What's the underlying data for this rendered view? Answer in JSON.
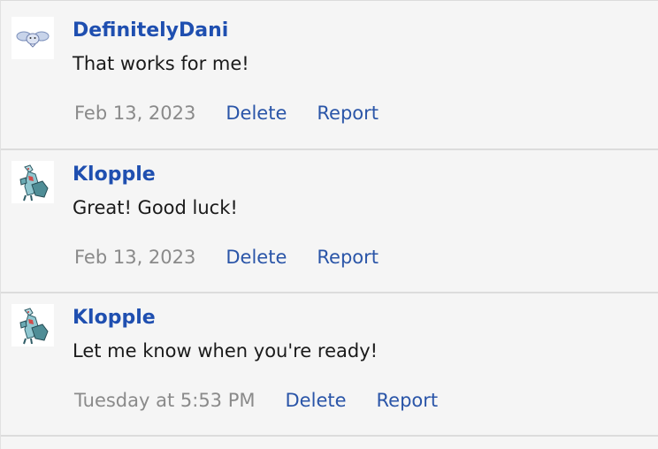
{
  "colors": {
    "username": "#1f4fb0",
    "link": "#2a55a8",
    "date": "#8a8a8a",
    "background": "#f5f5f5",
    "divider": "#dcdcdc"
  },
  "messages": [
    {
      "avatar_icon": "winged-creature-avatar-icon",
      "username": "DefinitelyDani",
      "text": "That works for me!",
      "date": "Feb 13, 2023",
      "delete_label": "Delete",
      "report_label": "Report"
    },
    {
      "avatar_icon": "dragon-sprite-avatar-icon",
      "username": "Klopple",
      "text": "Great! Good luck!",
      "date": "Feb 13, 2023",
      "delete_label": "Delete",
      "report_label": "Report"
    },
    {
      "avatar_icon": "dragon-sprite-avatar-icon",
      "username": "Klopple",
      "text": "Let me know when you're ready!",
      "date": "Tuesday at 5:53 PM",
      "delete_label": "Delete",
      "report_label": "Report"
    }
  ]
}
